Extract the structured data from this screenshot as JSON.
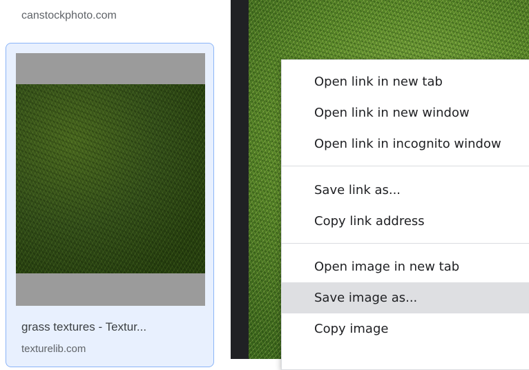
{
  "results": {
    "site_top": "canstockphoto.com",
    "card": {
      "title": "grass textures - Textur...",
      "source": "texturelib.com"
    }
  },
  "context_menu": {
    "groups": [
      [
        "Open link in new tab",
        "Open link in new window",
        "Open link in incognito window"
      ],
      [
        "Save link as...",
        "Copy link address"
      ],
      [
        "Open image in new tab",
        "Save image as...",
        "Copy image"
      ]
    ],
    "highlighted_item": "Save image as..."
  },
  "colors": {
    "card_border": "#8ab4f8",
    "card_background": "#e8f0fe",
    "menu_highlight": "#dedfe2",
    "dark_bar": "#202124"
  }
}
